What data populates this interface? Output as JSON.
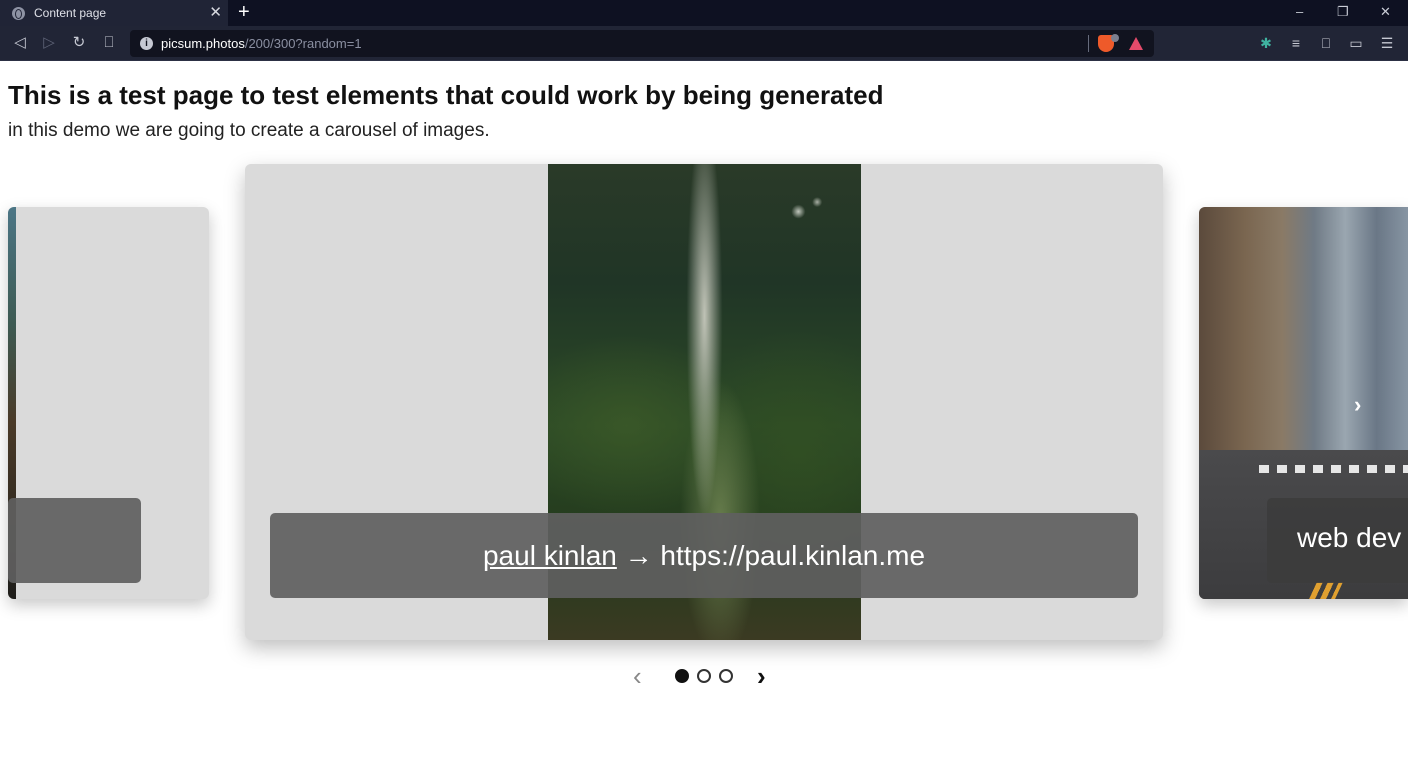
{
  "browser": {
    "tab_title": "Content page",
    "tab_close": "✕",
    "new_tab": "+",
    "url_host": "picsum.photos",
    "url_path": "/200/300?random=1",
    "window_minimize": "–",
    "window_restore": "❐",
    "window_close": "✕"
  },
  "page": {
    "heading": "This is a test page to test elements that could work by being generated",
    "subtitle": "in this demo we are going to create a carousel of images."
  },
  "carousel": {
    "center_caption_link": "paul kinlan",
    "center_caption_rest": " → https://paul.kinlan.me",
    "right_caption": "web dev",
    "left_caption": "",
    "active_index": 0,
    "dot_count": 3,
    "prev_label": "‹",
    "next_label": "›",
    "slide_next_glyph": "›"
  },
  "colors": {
    "tabstrip": "#0e1122",
    "toolbar": "#212536",
    "caption_bg": "#5f5f5f",
    "slide_bg": "#dadada"
  },
  "icons": [
    "globe-icon",
    "close-icon",
    "plus-icon",
    "back-icon",
    "forward-icon",
    "reload-icon",
    "bookmark-icon",
    "info-icon",
    "brave-shield-icon",
    "rewards-icon",
    "extensions-icon",
    "reading-list-icon",
    "bookmarks-icon",
    "wallet-icon",
    "menu-icon",
    "chevron-left-icon",
    "chevron-right-icon"
  ]
}
